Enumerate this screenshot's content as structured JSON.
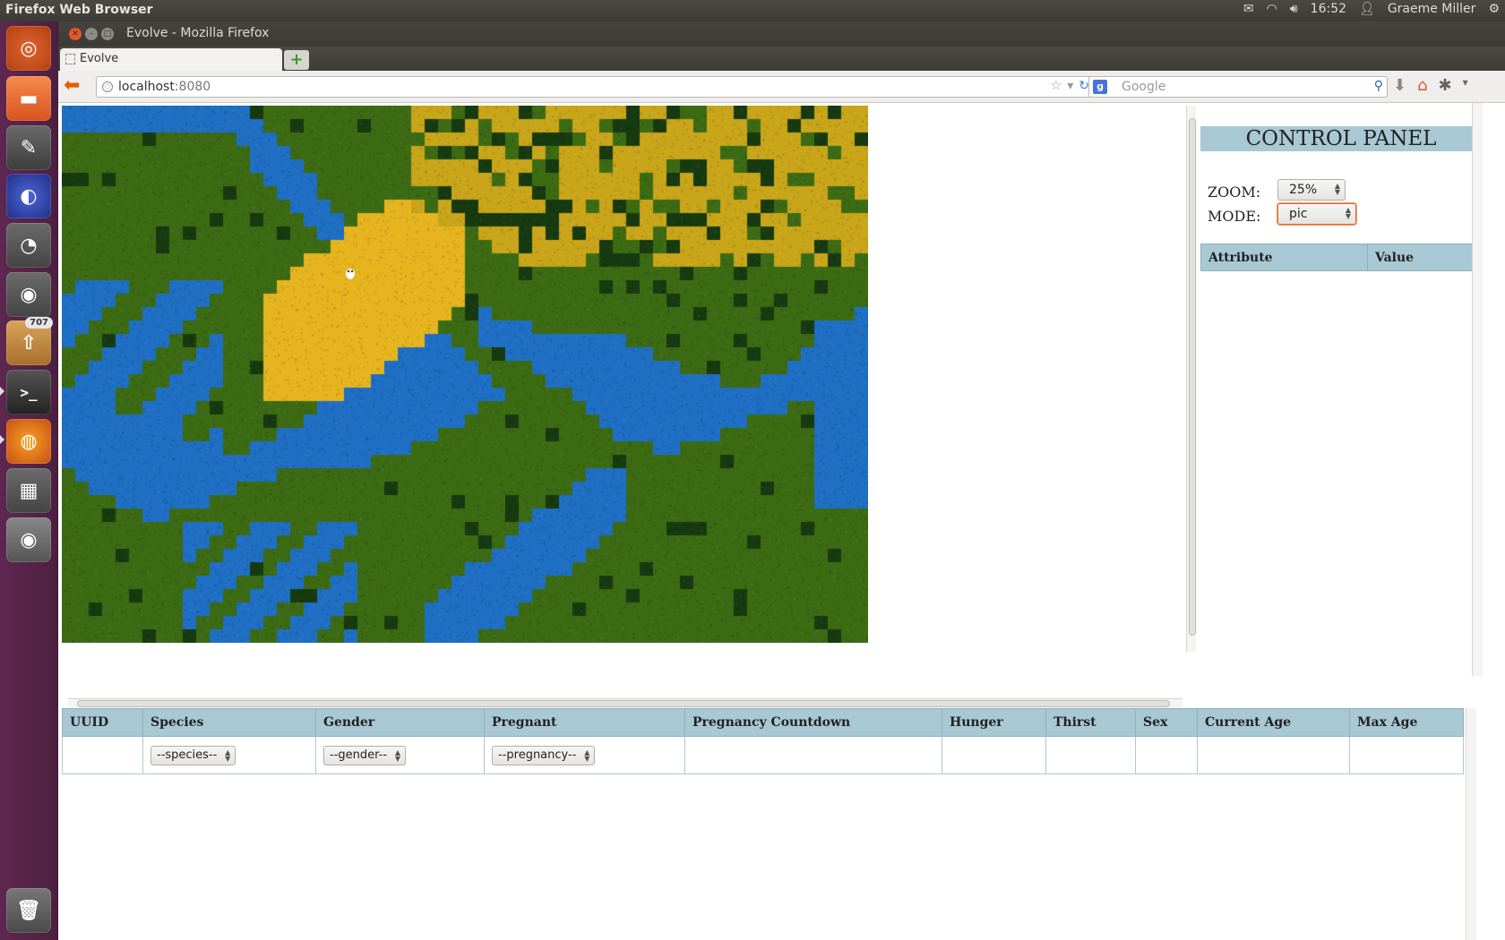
{
  "system": {
    "app_name": "Firefox Web Browser",
    "time": "16:52",
    "user": "Graeme Miller"
  },
  "launcher": {
    "badge": "707"
  },
  "window": {
    "title": "Evolve - Mozilla Firefox"
  },
  "tabs": [
    {
      "label": "Evolve"
    }
  ],
  "navbar": {
    "url_host": "localhost",
    "url_port": ":8080",
    "search_placeholder": "Google"
  },
  "map": {
    "grid_cols": 60,
    "grid_rows": 40,
    "terrain_colors": {
      "water": "#1f6fc4",
      "grass": "#3c6b14",
      "forest": "#173a10",
      "desert": "#e5b41e",
      "desert_plants": "#c9a51a"
    }
  },
  "control_panel": {
    "title": "CONTROL PANEL",
    "zoom_label": "ZOOM:",
    "zoom_value": "25%",
    "mode_label": "MODE:",
    "mode_value": "pic",
    "attr_headers": [
      "Attribute",
      "Value"
    ]
  },
  "organisms": {
    "headers": [
      "UUID",
      "Species",
      "Gender",
      "Pregnant",
      "Pregnancy Countdown",
      "Hunger",
      "Thirst",
      "Sex",
      "Current Age",
      "Max Age"
    ],
    "filters": {
      "species": "--species--",
      "gender": "--gender--",
      "pregnancy": "--pregnancy--"
    }
  }
}
